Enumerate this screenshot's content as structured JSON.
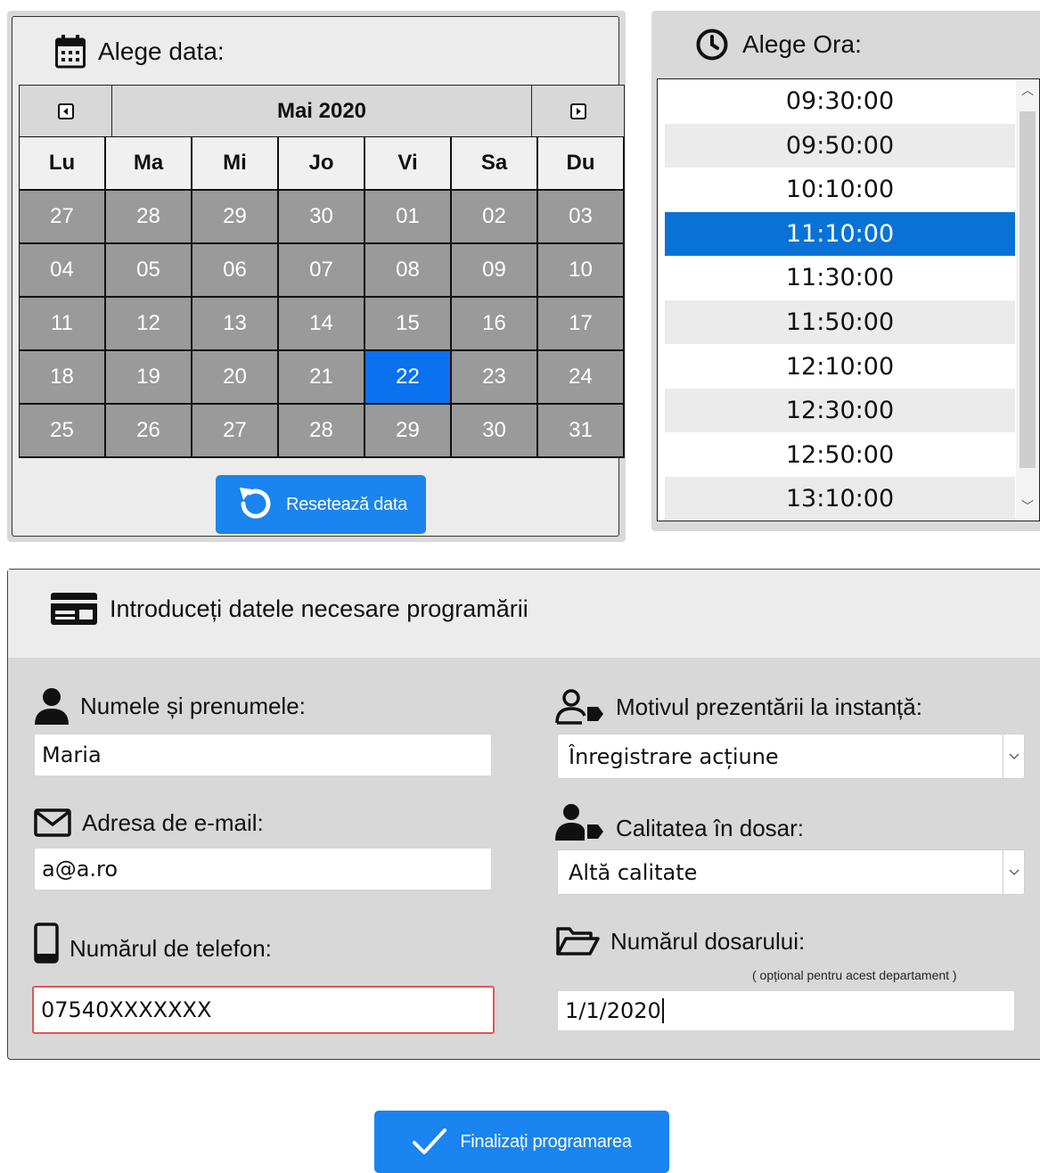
{
  "date_section": {
    "title": "Alege data:",
    "month_label": "Mai 2020",
    "weekdays": [
      "Lu",
      "Ma",
      "Mi",
      "Jo",
      "Vi",
      "Sa",
      "Du"
    ],
    "weeks": [
      [
        "27",
        "28",
        "29",
        "30",
        "01",
        "02",
        "03"
      ],
      [
        "04",
        "05",
        "06",
        "07",
        "08",
        "09",
        "10"
      ],
      [
        "11",
        "12",
        "13",
        "14",
        "15",
        "16",
        "17"
      ],
      [
        "18",
        "19",
        "20",
        "21",
        "22",
        "23",
        "24"
      ],
      [
        "25",
        "26",
        "27",
        "28",
        "29",
        "30",
        "31"
      ]
    ],
    "selected_day": "22",
    "reset_label": "Resetează data"
  },
  "time_section": {
    "title": "Alege Ora:",
    "times": [
      "09:30:00",
      "09:50:00",
      "10:10:00",
      "11:10:00",
      "11:30:00",
      "11:50:00",
      "12:10:00",
      "12:30:00",
      "12:50:00",
      "13:10:00"
    ],
    "selected_time": "11:10:00"
  },
  "form": {
    "title": "Introduceți datele necesare programării",
    "name_label": "Numele și prenumele:",
    "name_value": "Maria",
    "email_label": "Adresa de e-mail:",
    "email_value": "a@a.ro",
    "phone_label": "Numărul de telefon:",
    "phone_value": "07540XXXXXXX",
    "reason_label": "Motivul prezentării la instanță:",
    "reason_value": "Înregistrare acțiune",
    "quality_label": "Calitatea în dosar:",
    "quality_value": "Altă calitate",
    "case_label": "Numărul dosarului:",
    "case_hint": "( opțional pentru acest departament )",
    "case_value": "1/1/2020"
  },
  "submit_label": "Finalizați programarea",
  "colors": {
    "accent": "#1a84f0",
    "selected_day": "#0a72ef",
    "selected_time": "#0a72d6",
    "day_cell": "#9a9a9a",
    "error_border": "#e35555"
  }
}
